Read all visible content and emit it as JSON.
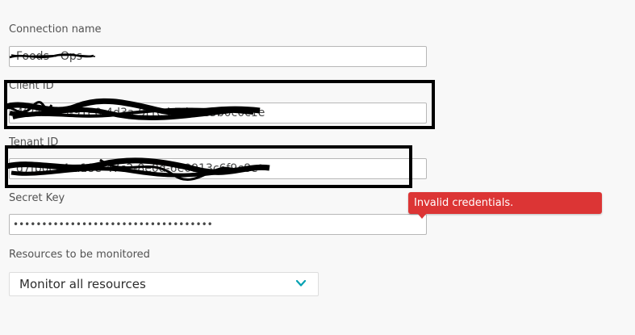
{
  "form": {
    "connection_name": {
      "label": "Connection name",
      "value": "Foods - Ops"
    },
    "client_id": {
      "label": "Client ID",
      "value": "4f2ab8c9-91e0-4d3a-9f1c-b7d3ee5b0c0c1e"
    },
    "tenant_id": {
      "label": "Tenant ID",
      "value": "d7fb0ec4-a18e-47c2-8e0d-6e0913c6f9c8e"
    },
    "secret_key": {
      "label": "Secret Key",
      "value": "•••••••••••••••••••••••••••••••••••"
    },
    "resources": {
      "label": "Resources to be monitored",
      "selected": "Monitor all resources"
    }
  },
  "error_tooltip": {
    "message": "Invalid credentials."
  },
  "colors": {
    "error": "#dc3535",
    "chevron": "#00a1b2",
    "redaction": "#000000"
  },
  "icons": {
    "dropdown": "chevron-down-icon"
  }
}
